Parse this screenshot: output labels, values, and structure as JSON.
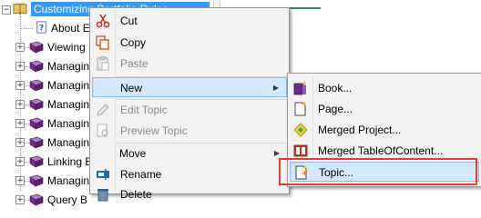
{
  "tree": {
    "root_label": "Customizing Portfolio Rules",
    "items": [
      {
        "label": "About Ex"
      },
      {
        "label": "Viewing E"
      },
      {
        "label": "Managing"
      },
      {
        "label": "Managing"
      },
      {
        "label": "Managing"
      },
      {
        "label": "Managing"
      },
      {
        "label": "Managing"
      },
      {
        "label": "Linking E"
      },
      {
        "label": "Managing"
      },
      {
        "label": "Query B"
      }
    ]
  },
  "context_menu": {
    "items": [
      {
        "label": "Cut",
        "disabled": false,
        "icon": "scissors-icon"
      },
      {
        "label": "Copy",
        "disabled": false,
        "icon": "copy-icon"
      },
      {
        "label": "Paste",
        "disabled": true,
        "icon": "paste-icon"
      },
      {
        "label": "New",
        "disabled": false,
        "icon": "",
        "submenu": true,
        "highlighted": true
      },
      {
        "label": "Edit Topic",
        "disabled": true,
        "icon": "pencil-icon"
      },
      {
        "label": "Preview Topic",
        "disabled": true,
        "icon": "eye-icon"
      },
      {
        "label": "Move",
        "disabled": false,
        "icon": "",
        "submenu": true
      },
      {
        "label": "Rename",
        "disabled": false,
        "icon": "rename-icon"
      },
      {
        "label": "Delete",
        "disabled": false,
        "icon": "delete-icon"
      }
    ]
  },
  "new_submenu": {
    "items": [
      {
        "label": "Book...",
        "icon": "new-book-icon"
      },
      {
        "label": "Page...",
        "icon": "new-page-icon"
      },
      {
        "label": "Merged Project...",
        "icon": "merged-project-icon"
      },
      {
        "label": "Merged TableOfContent...",
        "icon": "merged-toc-icon"
      },
      {
        "label": "Topic...",
        "icon": "new-topic-icon",
        "highlighted": true
      }
    ]
  },
  "colors": {
    "selection": "#3399ff",
    "menu_bg": "#f2f2f2",
    "menu_hover": "#d1e8ff",
    "annotation_red": "#e03c3c",
    "book_purple": "#7a2a8a"
  }
}
